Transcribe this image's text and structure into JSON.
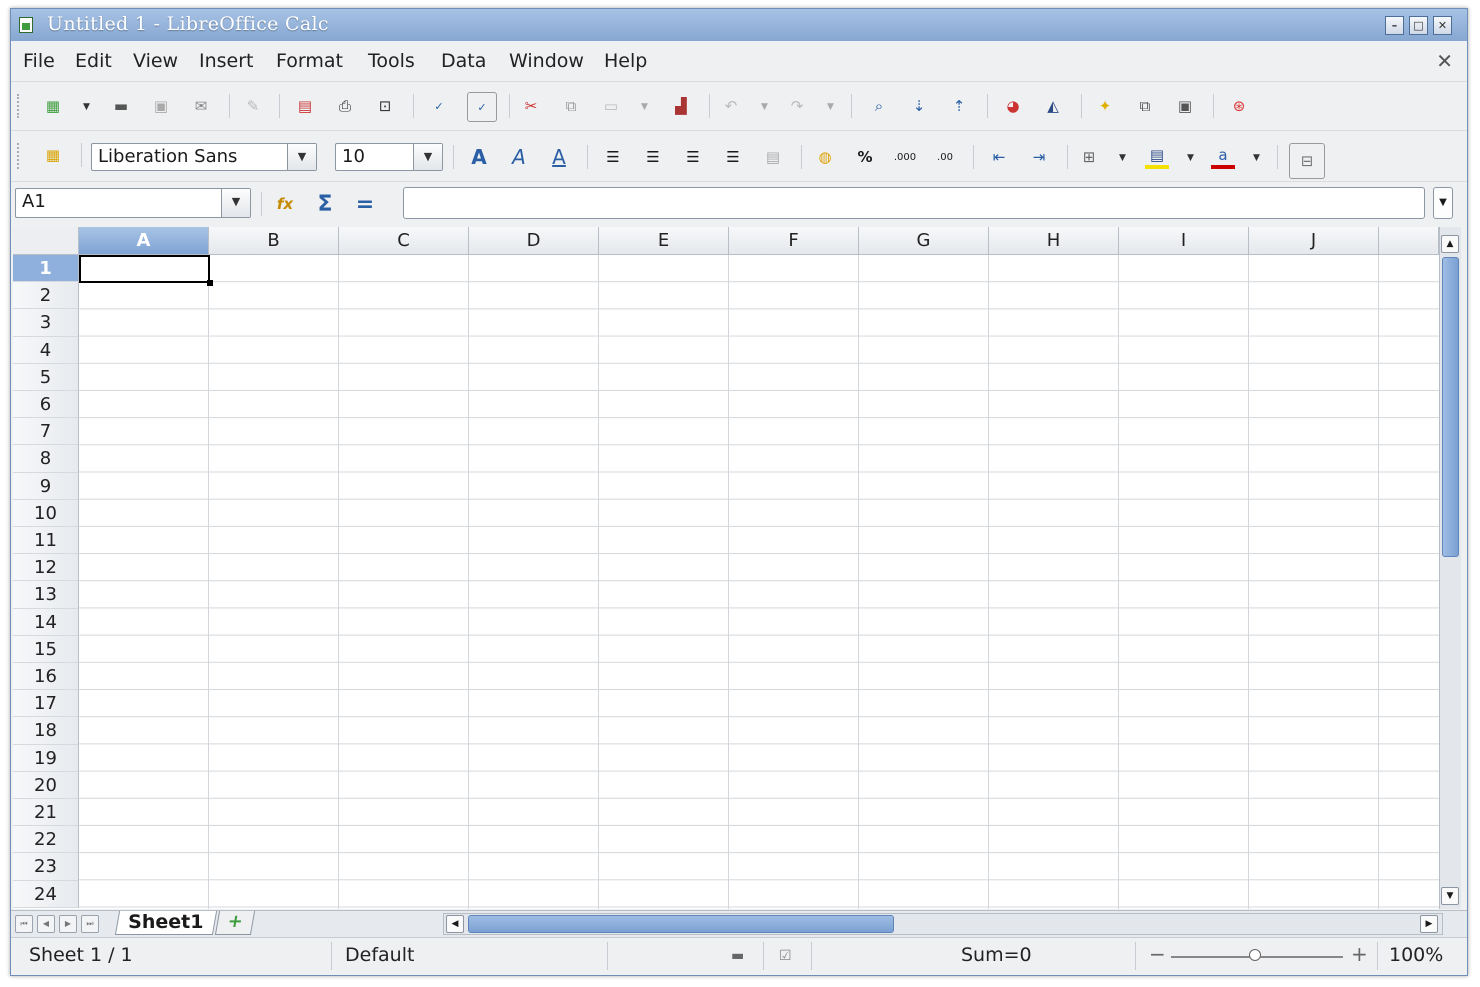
{
  "window": {
    "title": "Untitled 1 - LibreOffice Calc"
  },
  "menu": [
    "File",
    "Edit",
    "View",
    "Insert",
    "Format",
    "Tools",
    "Data",
    "Window",
    "Help"
  ],
  "font": {
    "name": "Liberation Sans",
    "size": "10"
  },
  "name_box": "A1",
  "formula_value": "",
  "columns": [
    "A",
    "B",
    "C",
    "D",
    "E",
    "F",
    "G",
    "H",
    "I",
    "J"
  ],
  "rows": [
    "1",
    "2",
    "3",
    "4",
    "5",
    "6",
    "7",
    "8",
    "9",
    "10",
    "11",
    "12",
    "13",
    "14",
    "15",
    "16",
    "17",
    "18",
    "19",
    "20",
    "21",
    "22",
    "23",
    "24"
  ],
  "sheet_tab": "Sheet1",
  "status": {
    "sheet": "Sheet 1 / 1",
    "page_style": "Default",
    "sum": "Sum=0",
    "zoom": "100%"
  },
  "colors": {
    "titlebar": "#86a7d2",
    "selection": "#8fb0dc",
    "window_bg": "#eef0f2"
  }
}
